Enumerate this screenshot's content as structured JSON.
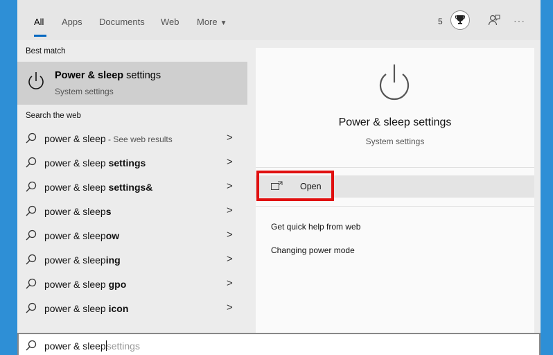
{
  "tabs": [
    {
      "label": "All"
    },
    {
      "label": "Apps"
    },
    {
      "label": "Documents"
    },
    {
      "label": "Web"
    },
    {
      "label": "More"
    }
  ],
  "rewards_count": "5",
  "best_match": {
    "section_label": "Best match",
    "title_bold": "Power & sleep",
    "title_rest": " settings",
    "subtitle": "System settings",
    "icon": "power-icon"
  },
  "search_web": {
    "section_label": "Search the web",
    "items": [
      {
        "prefix": "power & sleep",
        "bold": "",
        "suffix": " - See web results"
      },
      {
        "prefix": "power & sleep ",
        "bold": "settings",
        "suffix": ""
      },
      {
        "prefix": "power & sleep ",
        "bold": "settings&",
        "suffix": ""
      },
      {
        "prefix": "power & sleep",
        "bold": "s",
        "suffix": ""
      },
      {
        "prefix": "power & sleep",
        "bold": "ow",
        "suffix": ""
      },
      {
        "prefix": "power & sleep",
        "bold": "ing",
        "suffix": ""
      },
      {
        "prefix": "power & sleep ",
        "bold": "gpo",
        "suffix": ""
      },
      {
        "prefix": "power & sleep ",
        "bold": "icon",
        "suffix": ""
      }
    ]
  },
  "detail": {
    "title": "Power & sleep settings",
    "subtitle": "System settings",
    "open_label": "Open",
    "help_heading": "Get quick help from web",
    "help_link": "Changing power mode"
  },
  "search_box": {
    "typed": "power & sleep",
    "suggestion": "settings"
  },
  "colors": {
    "desktop": "#2e8fd6",
    "highlight_box": "#e01010",
    "selected_row": "#cfcfcf"
  }
}
